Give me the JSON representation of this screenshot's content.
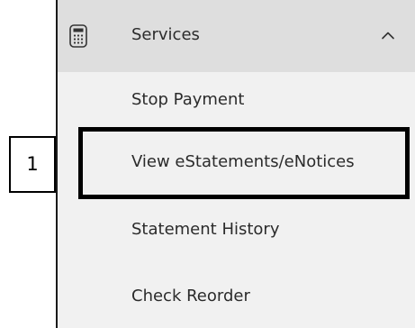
{
  "menu": {
    "header": {
      "label": "Services",
      "icon": "calculator-icon",
      "toggle_icon": "chevron-up-icon"
    },
    "items": [
      {
        "label": "Stop Payment"
      },
      {
        "label": "View eStatements/eNotices"
      },
      {
        "label": "Statement History"
      },
      {
        "label": "Check Reorder"
      }
    ]
  },
  "annotation": {
    "step_label": "1"
  }
}
